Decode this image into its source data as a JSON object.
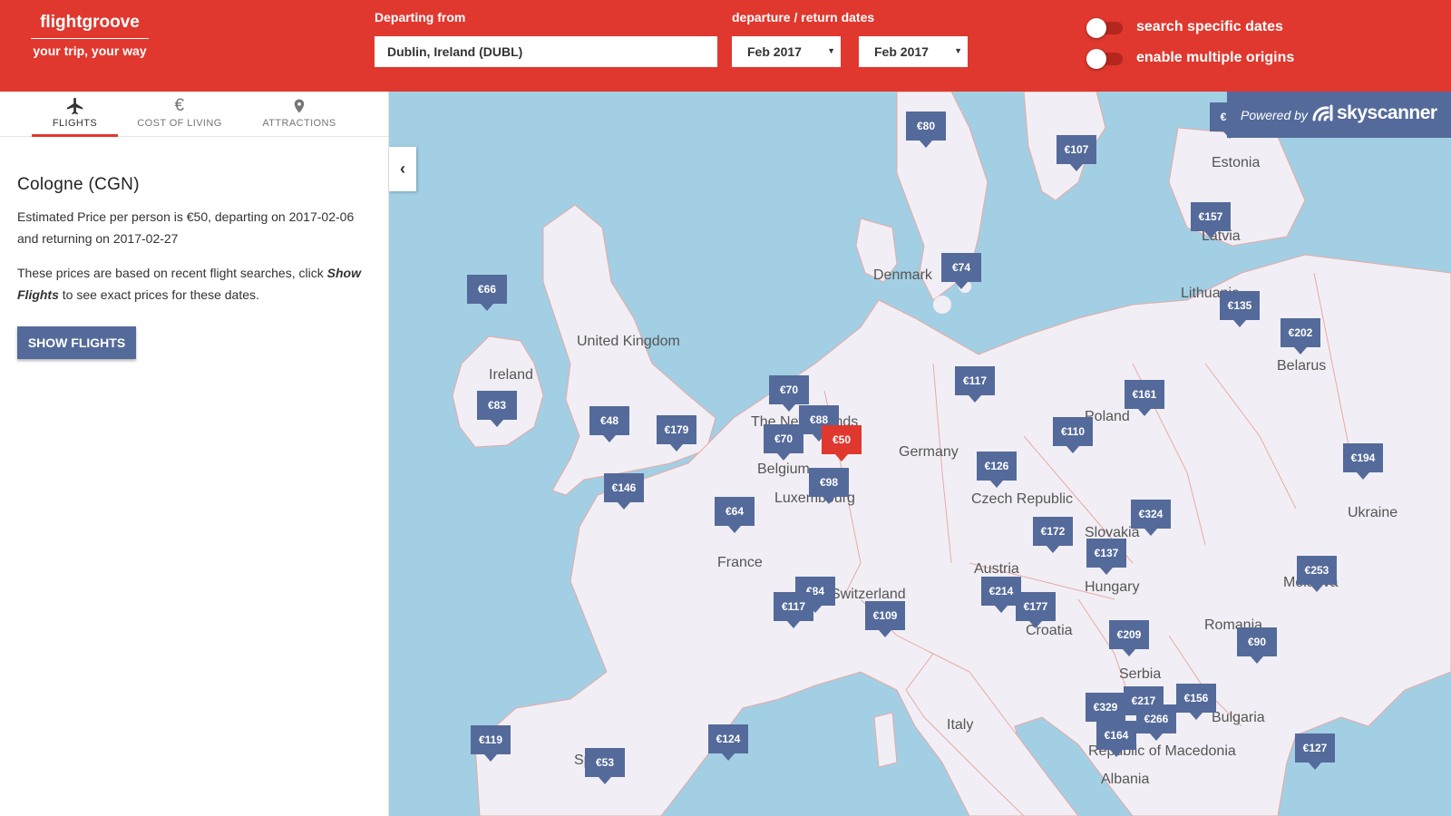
{
  "header": {
    "brand_name": "flightgroove",
    "brand_tagline": "your trip, your way",
    "departing_label": "Departing from",
    "departing_value": "Dublin, Ireland (DUBL)",
    "dates_label": "departure / return dates",
    "departure_month": "Feb 2017",
    "return_month": "Feb 2017",
    "toggle_specific_dates": "search specific dates",
    "toggle_multiple_origins": "enable multiple origins",
    "accent_color": "#e0382e"
  },
  "tabs": [
    {
      "label": "FLIGHTS",
      "icon": "airplane-icon",
      "active": true
    },
    {
      "label": "COST OF LIVING",
      "icon": "euro-icon",
      "active": false
    },
    {
      "label": "ATTRACTIONS",
      "icon": "map-pin-icon",
      "active": false
    }
  ],
  "detail": {
    "city": "Cologne (CGN)",
    "estimate_text": "Estimated Price per person is €50, departing on 2017-02-06 and returning on 2017-02-27",
    "note_prefix": "These prices are based on recent flight searches, click ",
    "note_emphasis": "Show Flights",
    "note_suffix": " to see exact prices for these dates.",
    "button_label": "SHOW FLIGHTS"
  },
  "map": {
    "powered_by": "Powered by",
    "provider": "skyscanner",
    "countries": [
      "Estonia",
      "Latvia",
      "Lithuania",
      "Denmark",
      "United Kingdom",
      "Ireland",
      "Belarus",
      "Poland",
      "The Netherlands",
      "Germany",
      "Belgium",
      "Luxembourg",
      "Czech Republic",
      "Ukraine",
      "Slovakia",
      "France",
      "Austria",
      "Hungary",
      "Switzerland",
      "Moldova",
      "Croatia",
      "Romania",
      "Serbia",
      "Italy",
      "Bulgaria",
      "Spain",
      "Republic of Macedonia",
      "Albania"
    ],
    "prices": [
      "€80",
      "€107",
      "€157",
      "€74",
      "€66",
      "€135",
      "€202",
      "€117",
      "€161",
      "€83",
      "€48",
      "€179",
      "€70",
      "€88",
      "€110",
      "€70",
      "€50",
      "€194",
      "€126",
      "€98",
      "€146",
      "€64",
      "€324",
      "€172",
      "€137",
      "€253",
      "€84",
      "€117",
      "€214",
      "€177",
      "€109",
      "€209",
      "€90",
      "€217",
      "€156",
      "€329",
      "€266",
      "€164",
      "€119",
      "€53",
      "€124",
      "€127",
      "€"
    ],
    "selected_price": "€50"
  }
}
